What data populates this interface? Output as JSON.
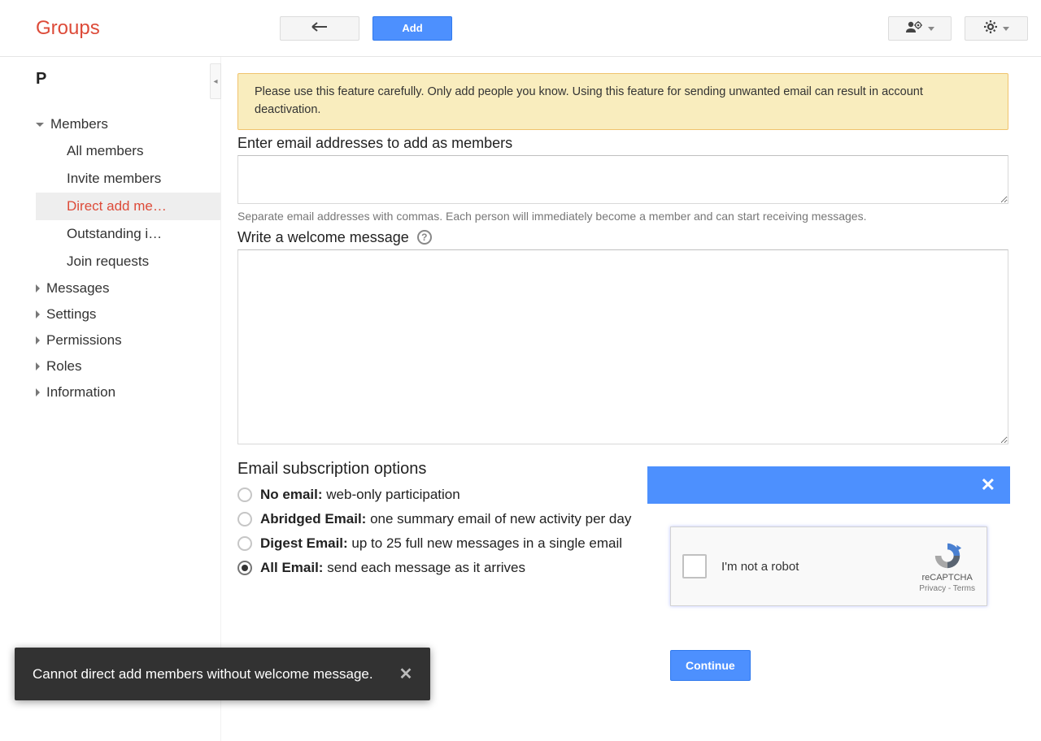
{
  "header": {
    "app_title": "Groups",
    "add_button": "Add"
  },
  "sidebar": {
    "group_letter": "P",
    "sections": {
      "members": {
        "label": "Members",
        "expanded": true,
        "items": [
          {
            "label": "All members",
            "active": false
          },
          {
            "label": "Invite members",
            "active": false
          },
          {
            "label": "Direct add me…",
            "active": true
          },
          {
            "label": "Outstanding i…",
            "active": false
          },
          {
            "label": "Join requests",
            "active": false
          }
        ]
      },
      "messages": {
        "label": "Messages",
        "expanded": false
      },
      "settings": {
        "label": "Settings",
        "expanded": false
      },
      "permissions": {
        "label": "Permissions",
        "expanded": false
      },
      "roles": {
        "label": "Roles",
        "expanded": false
      },
      "information": {
        "label": "Information",
        "expanded": false
      }
    }
  },
  "main": {
    "warning": "Please use this feature carefully. Only add people you know. Using this feature for sending unwanted email can result in account deactivation.",
    "emails_label": "Enter email addresses to add as members",
    "emails_value": "",
    "emails_hint": "Separate email addresses with commas. Each person will immediately become a member and can start receiving messages.",
    "welcome_label": "Write a welcome message",
    "welcome_value": "",
    "subscription_heading": "Email subscription options",
    "options": [
      {
        "key": "no_email",
        "title": "No email:",
        "desc": " web-only participation",
        "selected": false
      },
      {
        "key": "abridged",
        "title": "Abridged Email:",
        "desc": " one summary email of new activity per day",
        "selected": false
      },
      {
        "key": "digest",
        "title": "Digest Email:",
        "desc": " up to 25 full new messages in a single email",
        "selected": false
      },
      {
        "key": "all_email",
        "title": "All Email:",
        "desc": " send each message as it arrives",
        "selected": true
      }
    ]
  },
  "captcha": {
    "checkbox_label": "I'm not a robot",
    "brand": "reCAPTCHA",
    "links": "Privacy - Terms",
    "continue": "Continue"
  },
  "toast": {
    "message": "Cannot direct add members without welcome message."
  }
}
